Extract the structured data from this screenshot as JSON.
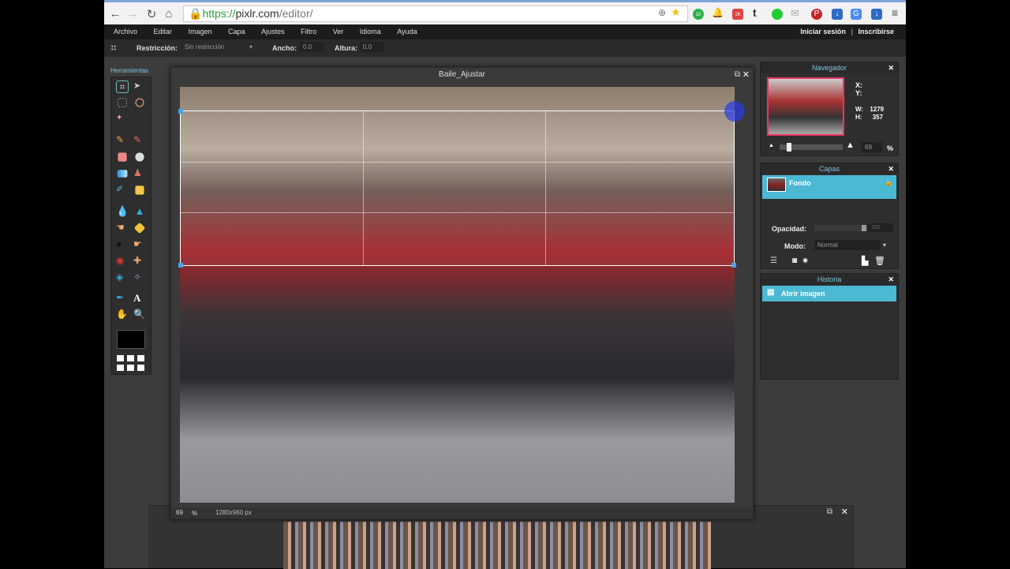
{
  "browser": {
    "url_secure": "https://",
    "url_host": "pixlr.com",
    "url_path": "/editor/",
    "extension_badges": {
      "ext1": "10",
      "ext2": "1K"
    }
  },
  "menu": [
    "Archivo",
    "Editar",
    "Imagen",
    "Capa",
    "Ajustes",
    "Filtro",
    "Ver",
    "Idioma",
    "Ayuda"
  ],
  "account": {
    "login": "Iniciar sesión",
    "sep": "|",
    "signup": "Inscribirse"
  },
  "options": {
    "restriccion_label": "Restricción:",
    "restriccion_value": "Sin restricción",
    "ancho_label": "Ancho:",
    "ancho_value": "0.0",
    "altura_label": "Altura:",
    "altura_value": "0.0"
  },
  "tools": {
    "title": "Herramientas"
  },
  "document": {
    "title": "Baile_Ajustar",
    "zoom": "69",
    "zoom_unit": "%",
    "size": "1280x960 px"
  },
  "navigator": {
    "title": "Navegador",
    "x_label": "X:",
    "y_label": "Y:",
    "w_label": "W:",
    "w_value": "1279",
    "h_label": "H:",
    "h_value": "357",
    "zoom": "69",
    "zoom_unit": "%"
  },
  "layers": {
    "title": "Capas",
    "items": [
      {
        "name": "Fondo"
      }
    ],
    "opacity_label": "Opacidad:",
    "opacity_value": "100",
    "mode_label": "Modo:",
    "mode_value": "Normal"
  },
  "history": {
    "title": "Historia",
    "items": [
      "Abrir imagen"
    ]
  },
  "colors": {
    "accent": "#4bb8d4",
    "bg": "#3c3c3c"
  }
}
